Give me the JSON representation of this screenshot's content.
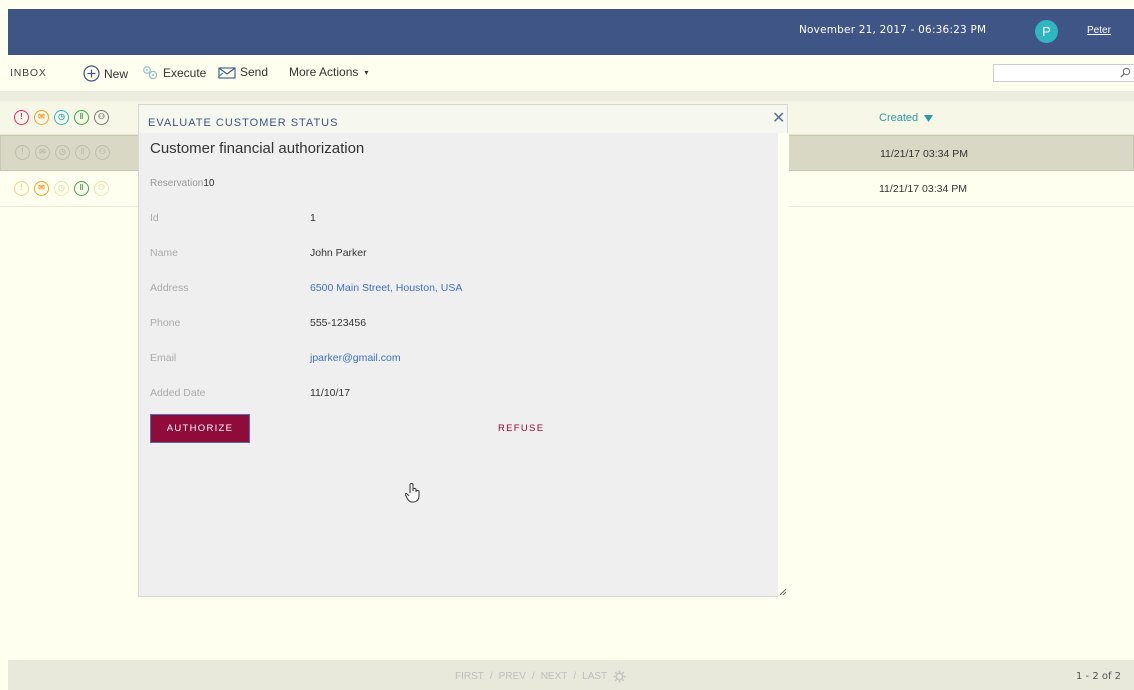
{
  "header": {
    "datetime": "November 21, 2017 - 06:36:23 PM",
    "avatar_initial": "P",
    "username": "Peter"
  },
  "toolbar": {
    "inbox_label": "INBOX",
    "new_label": "New",
    "execute_label": "Execute",
    "send_label": "Send",
    "more_actions_label": "More Actions"
  },
  "search": {
    "value": "",
    "placeholder": ""
  },
  "list": {
    "header_icons": [
      "alert-icon",
      "mail-icon",
      "clock-icon",
      "attachment-icon",
      "group-icon"
    ],
    "created_header": "Created",
    "rows": [
      {
        "created": "11/21/17 03:34 PM",
        "selected": true
      },
      {
        "created": "11/21/17 03:34 PM",
        "selected": false
      }
    ]
  },
  "modal": {
    "title": "EVALUATE CUSTOMER STATUS",
    "form_title": "Customer financial authorization",
    "reservation_label": "Reservation",
    "reservation_value": "10",
    "fields": [
      {
        "label": "Id",
        "value": "1",
        "link": false
      },
      {
        "label": "Name",
        "value": "John Parker",
        "link": false
      },
      {
        "label": "Address",
        "value": "6500 Main Street, Houston, USA",
        "link": true
      },
      {
        "label": "Phone",
        "value": "555-123456",
        "link": false
      },
      {
        "label": "Email",
        "value": "jparker@gmail.com",
        "link": true
      },
      {
        "label": "Added Date",
        "value": "11/10/17",
        "link": false
      }
    ],
    "authorize_label": "AUTHORIZE",
    "refuse_label": "REFUSE"
  },
  "footer": {
    "pager": [
      "FIRST",
      "PREV",
      "NEXT",
      "LAST"
    ],
    "count": "1 - 2 of 2"
  },
  "colors": {
    "header_bg": "#3e5585",
    "accent_teal": "#2e9aa8",
    "button_primary": "#8e0b3a",
    "link": "#3f6fbf"
  }
}
